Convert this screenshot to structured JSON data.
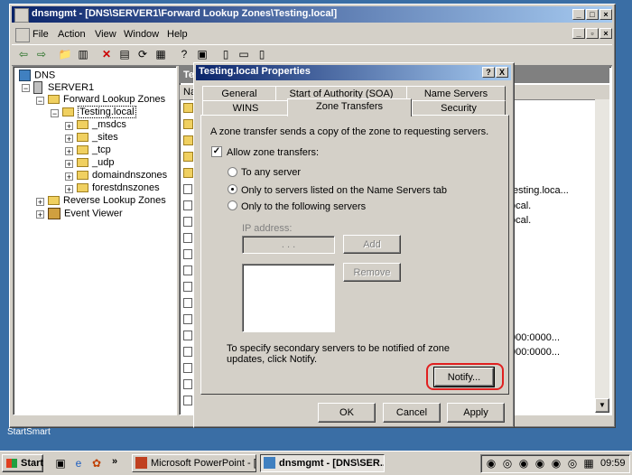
{
  "window": {
    "title": "dnsmgmt - [DNS\\SERVER1\\Forward Lookup Zones\\Testing.local]",
    "menu": [
      "File",
      "Action",
      "View",
      "Window",
      "Help"
    ]
  },
  "tree": {
    "root": "DNS",
    "server": "SERVER1",
    "forward": "Forward Lookup Zones",
    "zone": "Testing.local",
    "children": [
      "_msdcs",
      "_sites",
      "_tcp",
      "_udp",
      "domaindnszones",
      "forestdnszones"
    ],
    "reverse": "Reverse Lookup Zones",
    "events": "Event Viewer"
  },
  "list": {
    "header_left": "Te",
    "col_name": "Na",
    "right_values": [
      "testing.loca...",
      "ocal.",
      "ocal.",
      "000:0000...",
      "000:0000..."
    ]
  },
  "dialog": {
    "title": "Testing.local Properties",
    "help_btn": "?",
    "close_btn": "X",
    "tabs_back": [
      "General",
      "Start of Authority (SOA)",
      "Name Servers"
    ],
    "tabs_front": [
      "WINS",
      "Zone Transfers",
      "Security"
    ],
    "intro": "A zone transfer sends a copy of the zone to requesting servers.",
    "allow_label": "Allow zone transfers:",
    "radio_any": "To any server",
    "radio_listed": "Only to servers listed on the Name Servers tab",
    "radio_following": "Only to the following servers",
    "ip_label": "IP address:",
    "ip_placeholder": ".   .   .",
    "add_btn": "Add",
    "remove_btn": "Remove",
    "notify_text": "To specify secondary servers to be notified of zone updates, click Notify.",
    "notify_btn": "Notify...",
    "ok_btn": "OK",
    "cancel_btn": "Cancel",
    "apply_btn": "Apply"
  },
  "taskbar": {
    "start": "Start",
    "chevron": "»",
    "task1": "Microsoft PowerPoint - [...",
    "task2": "dnsmgmt - [DNS\\SER...",
    "clock": "09:59"
  },
  "desktop": {
    "label": "StartSmart"
  },
  "colors": {
    "highlight_circle": "#e02020",
    "titlebar": "#0a246a"
  }
}
